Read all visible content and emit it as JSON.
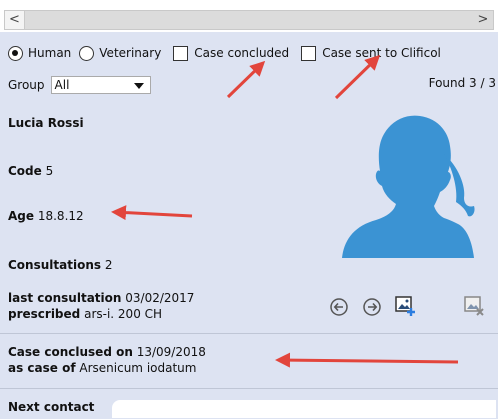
{
  "scrollbar": {
    "left_arrow": "<",
    "right_arrow": ">"
  },
  "options": {
    "human": "Human",
    "veterinary": "Veterinary",
    "case_concluded": "Case concluded",
    "case_sent": "Case sent to Clificol"
  },
  "group": {
    "label": "Group",
    "value": "All"
  },
  "found": "Found 3 / 3",
  "patient": {
    "name": "Lucia Rossi",
    "code_label": "Code",
    "code_value": "5",
    "age_label": "Age",
    "age_value": "18.8.12",
    "consultations_label": "Consultations",
    "consultations_value": "2",
    "last_consultation_label": "last consultation",
    "last_consultation_value": "03/02/2017",
    "prescribed_label": "prescribed",
    "prescribed_value": "ars-i. 200 CH"
  },
  "conclusion": {
    "label": "Case conclused on",
    "date": "13/09/2018",
    "as_case_label": "as case of",
    "remedy": "Arsenicum iodatum"
  },
  "next_contact": {
    "label": "Next contact",
    "value": ""
  },
  "colors": {
    "panel_bg": "#dde3f2",
    "avatar": "#3b93d3",
    "annotation_arrow": "#e2453c"
  },
  "icons": [
    "arrow-left-circle-icon",
    "arrow-right-circle-icon",
    "add-image-icon",
    "remove-image-icon",
    "avatar-silhouette-icon"
  ]
}
